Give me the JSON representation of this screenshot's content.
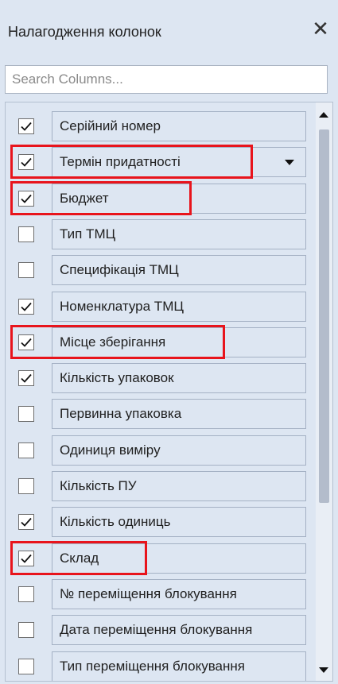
{
  "panel": {
    "title": "Налагодження колонок",
    "close_symbol": "✕"
  },
  "search": {
    "placeholder": "Search Columns...",
    "value": ""
  },
  "columns": [
    {
      "label": "Серійний номер",
      "checked": true,
      "highlighted": false
    },
    {
      "label": "Термін придатності",
      "checked": true,
      "highlighted": true,
      "has_dropdown": true
    },
    {
      "label": "Бюджет",
      "checked": true,
      "highlighted": true
    },
    {
      "label": "Тип ТМЦ",
      "checked": false,
      "highlighted": false
    },
    {
      "label": "Специфікація ТМЦ",
      "checked": false,
      "highlighted": false
    },
    {
      "label": "Номенклатура ТМЦ",
      "checked": true,
      "highlighted": false
    },
    {
      "label": "Місце зберігання",
      "checked": true,
      "highlighted": true
    },
    {
      "label": "Кількість упаковок",
      "checked": true,
      "highlighted": false
    },
    {
      "label": "Первинна упаковка",
      "checked": false,
      "highlighted": false
    },
    {
      "label": "Одиниця виміру",
      "checked": false,
      "highlighted": false
    },
    {
      "label": "Кількість ПУ",
      "checked": false,
      "highlighted": false
    },
    {
      "label": "Кількість одиниць",
      "checked": true,
      "highlighted": false
    },
    {
      "label": "Склад",
      "checked": true,
      "highlighted": true
    },
    {
      "label": "№ переміщення блокування",
      "checked": false,
      "highlighted": false
    },
    {
      "label": "Дата переміщення блокування",
      "checked": false,
      "highlighted": false
    },
    {
      "label": "Тип переміщення блокування",
      "checked": false,
      "highlighted": false
    }
  ],
  "colors": {
    "panel_bg": "#dde6f2",
    "highlight": "#e8141c"
  }
}
